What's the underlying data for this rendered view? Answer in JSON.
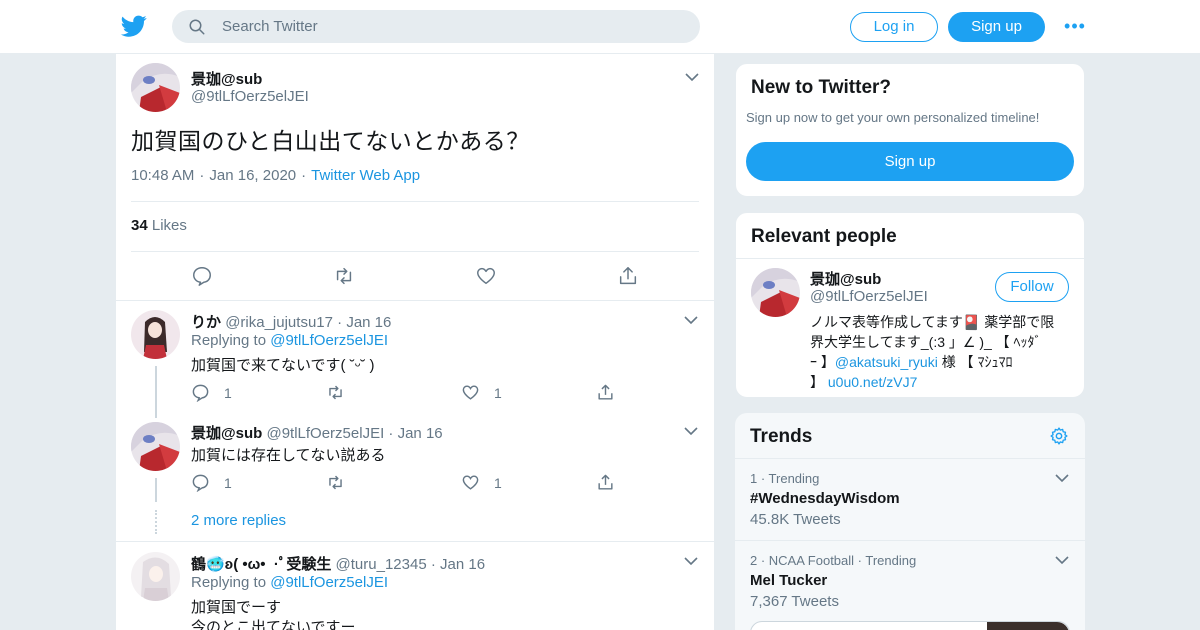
{
  "header": {
    "search_placeholder": "Search Twitter",
    "login_label": "Log in",
    "signup_label": "Sign up",
    "more_label": "•••"
  },
  "tweet": {
    "name": "景珈@sub",
    "handle": "@9tlLfOerz5elJEI",
    "text": "加賀国のひと白山出てないとかある？",
    "time": "10:48 AM",
    "date": "Jan 16, 2020",
    "source": "Twitter Web App",
    "likes_count": "34",
    "likes_label": "Likes"
  },
  "replies": [
    {
      "name": "りか",
      "handle": "@rika_jujutsu17",
      "date": "Jan 16",
      "replying_label": "Replying to",
      "replying_to": "@9tlLfOerz5elJEI",
      "text": "加賀国で来てないです( ˘ᵕ˘ )",
      "reply_count": "1",
      "like_count": "1"
    },
    {
      "name": "景珈@sub",
      "handle": "@9tlLfOerz5elJEI",
      "date": "Jan 16",
      "text": "加賀には存在してない説ある",
      "reply_count": "1",
      "like_count": "1"
    },
    {
      "name": "鶴🥶ʚ( •ω• ︎︎ ︎︎·ﾟ受験生",
      "handle": "@turu_12345",
      "date": "Jan 16",
      "replying_label": "Replying to",
      "replying_to": "@9tlLfOerz5elJEI",
      "text_line1": "加賀国でーす",
      "text_line2": "今のとこ出てないですー"
    }
  ],
  "more_replies": "2 more replies",
  "sidebar": {
    "new_title": "New to Twitter?",
    "new_subtitle": "Sign up now to get your own personalized timeline!",
    "new_signup": "Sign up",
    "relevant_title": "Relevant people",
    "person": {
      "name": "景珈@sub",
      "handle": "@9tlLfOerz5elJEI",
      "follow": "Follow",
      "bio_line1": "ノルマ表等作成してます🎴 薬学部で限",
      "bio_line2": "界大学生してます_(:3 」∠ )_ 【 ﾍｯﾀﾞ",
      "bio_line3a": "ｰ 】",
      "bio_mention": "@akatsuki_ryuki",
      "bio_line3b": " 様 【 ﾏｼｭﾏﾛ",
      "bio_line4a": "】",
      "bio_link": "u0u0.net/zVJ7"
    },
    "trends_title": "Trends",
    "trends": [
      {
        "meta": "1 · Trending",
        "name": "#WednesdayWisdom",
        "count": "45.8K Tweets"
      },
      {
        "meta": "2 · NCAA Football · Trending",
        "name": "Mel Tucker",
        "count": "7,367 Tweets"
      }
    ]
  },
  "colors": {
    "brand": "#1da1f2",
    "link": "#1b95e0",
    "muted": "#657786",
    "border": "#e6ecf0"
  }
}
